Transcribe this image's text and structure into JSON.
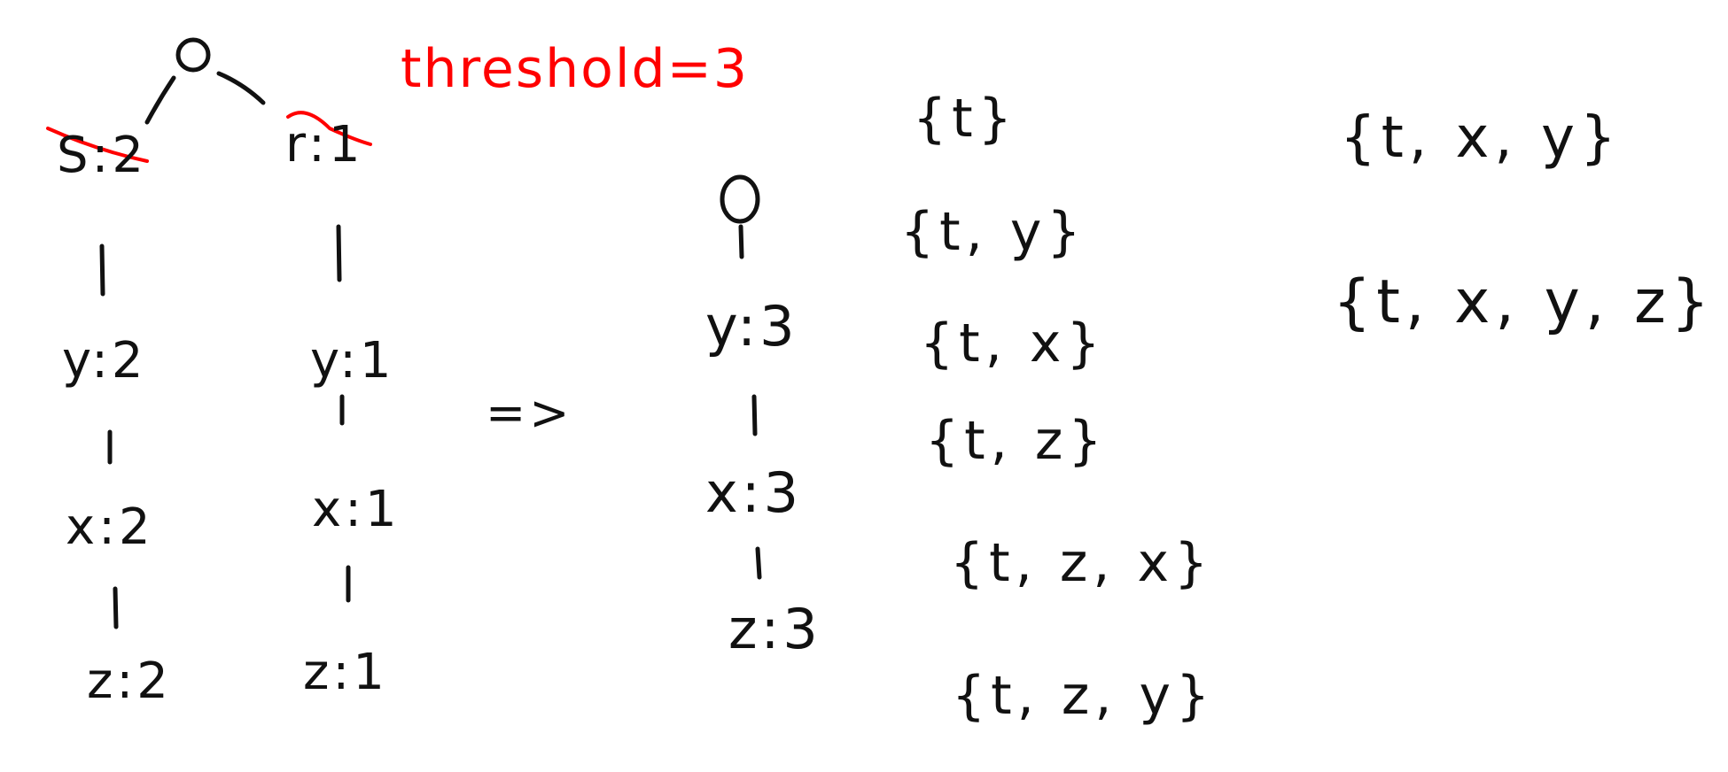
{
  "threshold_label": "threshold=3",
  "left_tree": {
    "root": "o",
    "branches": [
      {
        "nodes": [
          "S:2",
          "y:2",
          "x:2",
          "z:2"
        ],
        "crossed_first": true
      },
      {
        "nodes": [
          "r:1",
          "y:1",
          "x:1",
          "z:1"
        ],
        "crossed_first": true
      }
    ]
  },
  "arrow": "=>",
  "right_tree": {
    "root": "o",
    "nodes": [
      "y:3",
      "x:3",
      "z:3"
    ]
  },
  "itemsets": {
    "col1": [
      "{t}",
      "{t, y}",
      "{t, x}",
      "{t, z}",
      "{t, z, x}",
      "{t, z, y}"
    ],
    "col2": [
      "{t, x, y}",
      "{t, x, y, z}"
    ]
  },
  "colors": {
    "ink": "#111111",
    "annotation": "#ff0000"
  }
}
